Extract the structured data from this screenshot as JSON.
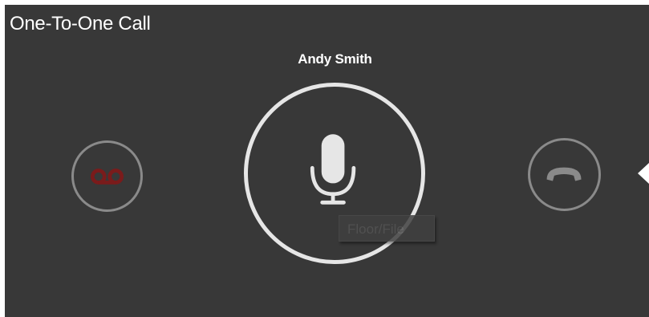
{
  "window": {
    "title": "One-To-One Call"
  },
  "call": {
    "caller_name": "Andy Smith"
  },
  "controls": {
    "voicemail_icon": "voicemail-icon",
    "mic_icon": "microphone-icon",
    "hangup_icon": "phone-hangup-icon",
    "tooltip_text": "Floor/File"
  },
  "colors": {
    "background": "#383838",
    "voicemail_accent": "#7a1b1b",
    "ring_light": "#e6e6e6",
    "ring_dim": "#8a8a8a"
  }
}
